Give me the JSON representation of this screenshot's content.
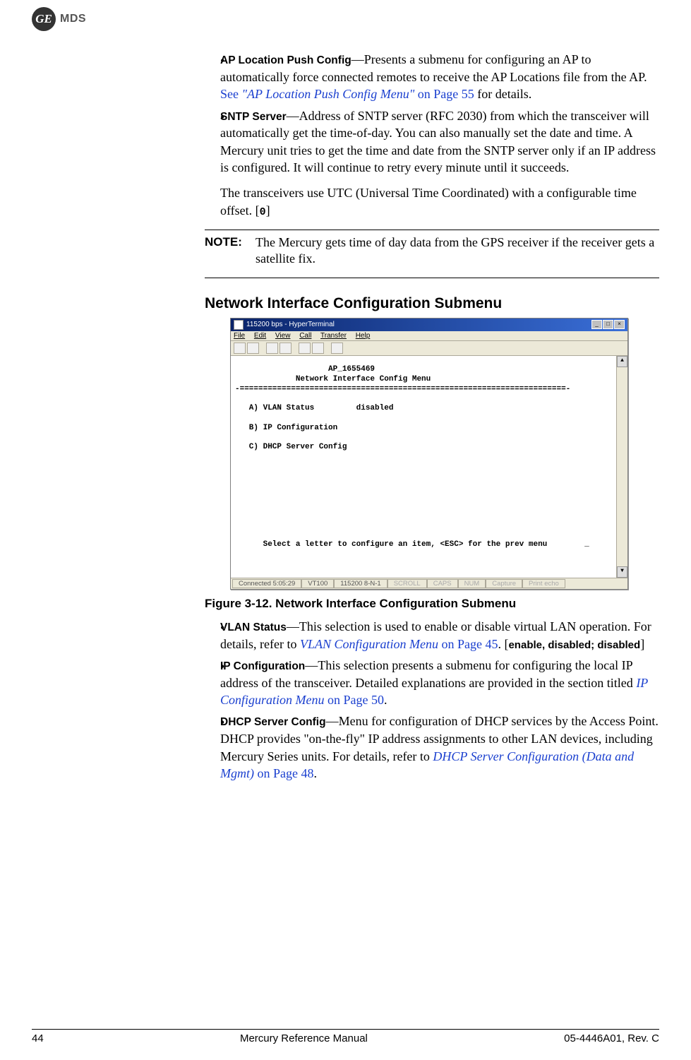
{
  "logo": {
    "ge": "GE",
    "mds": "MDS"
  },
  "bullets_top": [
    {
      "term": "AP Location Push Config",
      "text1": "—Presents a submenu for configuring an AP to automatically force connected remotes to receive the AP Locations file from the AP. ",
      "link_prefix": "See ",
      "link_italic": "\"AP Location Push Config Menu\"",
      "link_rest": " on Page 55",
      "after_link": " for details."
    },
    {
      "term": "SNTP Server",
      "text1": "—Address of SNTP server (RFC 2030) from which the transceiver will automatically get the time-of-day. You can also manually set the date and time. A Mercury unit tries to get the time and date from the SNTP server only if an IP address is configured. It will continue to retry every minute until it succeeds.",
      "extra_para": "The transceivers use UTC (Universal Time Coordinated) with a configurable time offset. [",
      "mono": "0",
      "extra_close": "]"
    }
  ],
  "note": {
    "label": "NOTE:",
    "text": "The Mercury gets time of day data from the GPS receiver if the receiver gets a satellite fix."
  },
  "section_title": "Network Interface Configuration Submenu",
  "terminal": {
    "title": "115200 bps - HyperTerminal",
    "menus": [
      "File",
      "Edit",
      "View",
      "Call",
      "Transfer",
      "Help"
    ],
    "host": "AP_1655469",
    "heading": "Network Interface Config Menu",
    "divider_left": "-=",
    "divider_right": "=-",
    "items": [
      {
        "key": "A) VLAN Status",
        "value": "disabled"
      },
      {
        "key": "B) IP Configuration",
        "value": ""
      },
      {
        "key": "C) DHCP Server Config",
        "value": ""
      }
    ],
    "prompt": "Select a letter to configure an item, <ESC> for the prev menu",
    "status": {
      "conn": "Connected 5:05:29",
      "emul": "VT100",
      "settings": "115200 8-N-1",
      "scroll": "SCROLL",
      "caps": "CAPS",
      "num": "NUM",
      "capture": "Capture",
      "echo": "Print echo"
    },
    "winbuttons": {
      "min": "_",
      "max": "□",
      "close": "×"
    },
    "scroll_up": "▲",
    "scroll_down": "▼"
  },
  "figure_caption": "Figure 3-12. Network Interface Configuration Submenu",
  "bullets_bottom": [
    {
      "term": "VLAN Status",
      "text1": "—This selection is used to enable or disable virtual LAN operation. For details, refer to ",
      "link_italic": "VLAN Configuration Menu",
      "link_rest": " on Page 45",
      "after_link": ". [",
      "sans_bold": "enable, disabled; disabled",
      "after_sans": "]"
    },
    {
      "term": "IP Configuration",
      "text1": "—This selection presents a submenu for configuring the local IP address of the transceiver. Detailed explanations are provided in the section titled ",
      "link_italic": "IP Configuration Menu",
      "link_rest": " on Page 50",
      "after_link": "."
    },
    {
      "term": "DHCP Server Config",
      "text1": "—Menu for configuration of DHCP services by the Access Point. DHCP provides \"on-the-fly\" IP address assignments to other LAN devices, including Mercury Series units. For details, refer to ",
      "link_italic": "DHCP Server Configuration (Data and Mgmt)",
      "link_rest": " on Page 48",
      "after_link": "."
    }
  ],
  "footer": {
    "page": "44",
    "center": "Mercury Reference Manual",
    "right": "05-4446A01, Rev. C"
  }
}
